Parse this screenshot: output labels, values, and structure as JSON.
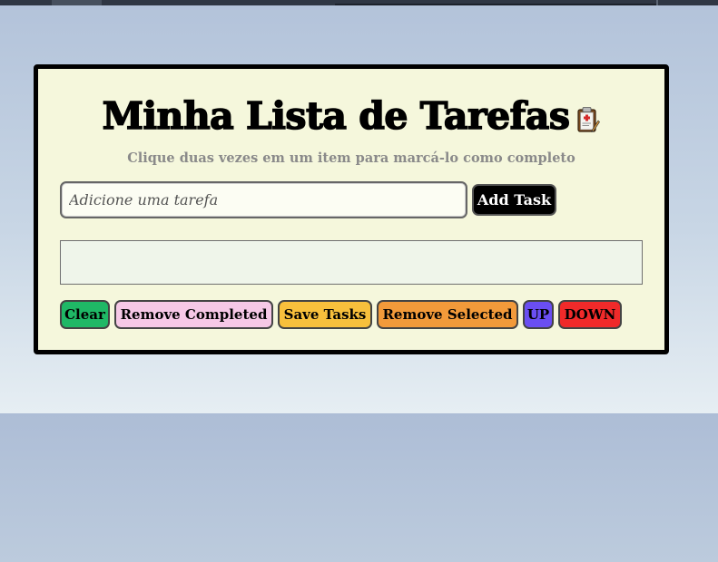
{
  "header": {
    "title": "Minha Lista de Tarefas",
    "title_icon": "clipboard-icon",
    "subtitle": "Clique duas vezes em um item para marcá-lo como completo"
  },
  "task_form": {
    "input_placeholder": "Adicione uma tarefa",
    "input_value": "",
    "add_button_label": "Add Task"
  },
  "task_list": {
    "items": []
  },
  "actions": {
    "clear_label": "Clear",
    "remove_completed_label": "Remove Completed",
    "save_label": "Save Tasks",
    "remove_selected_label": "Remove Selected",
    "up_label": "UP",
    "down_label": "DOWN"
  },
  "colors": {
    "card_background": "#f5f7dc",
    "clear": "#1fb866",
    "remove_completed": "#f6c8e6",
    "save": "#f8c03c",
    "remove_selected": "#f29a3a",
    "up": "#6a4ef2",
    "down": "#f02a2a"
  }
}
